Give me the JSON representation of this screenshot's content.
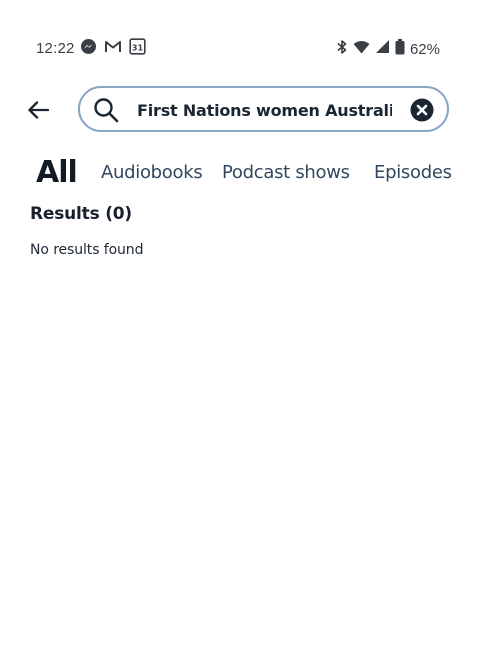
{
  "status_bar": {
    "time": "12:22",
    "left_icons": [
      "messenger-icon",
      "gmail-icon",
      "calendar-icon"
    ],
    "calendar_day": "31",
    "right_icons": [
      "bluetooth-icon",
      "wifi-icon",
      "cell-signal-icon",
      "battery-icon"
    ],
    "battery_percent": "62%"
  },
  "search": {
    "query": "First Nations women Australia",
    "border_color": "#8aa4c6"
  },
  "tabs": [
    {
      "label": "All",
      "active": true
    },
    {
      "label": "Audiobooks",
      "active": false
    },
    {
      "label": "Podcast shows",
      "active": false
    },
    {
      "label": "Episodes",
      "active": false
    }
  ],
  "results": {
    "title": "Results (0)",
    "empty_message": "No results found"
  }
}
